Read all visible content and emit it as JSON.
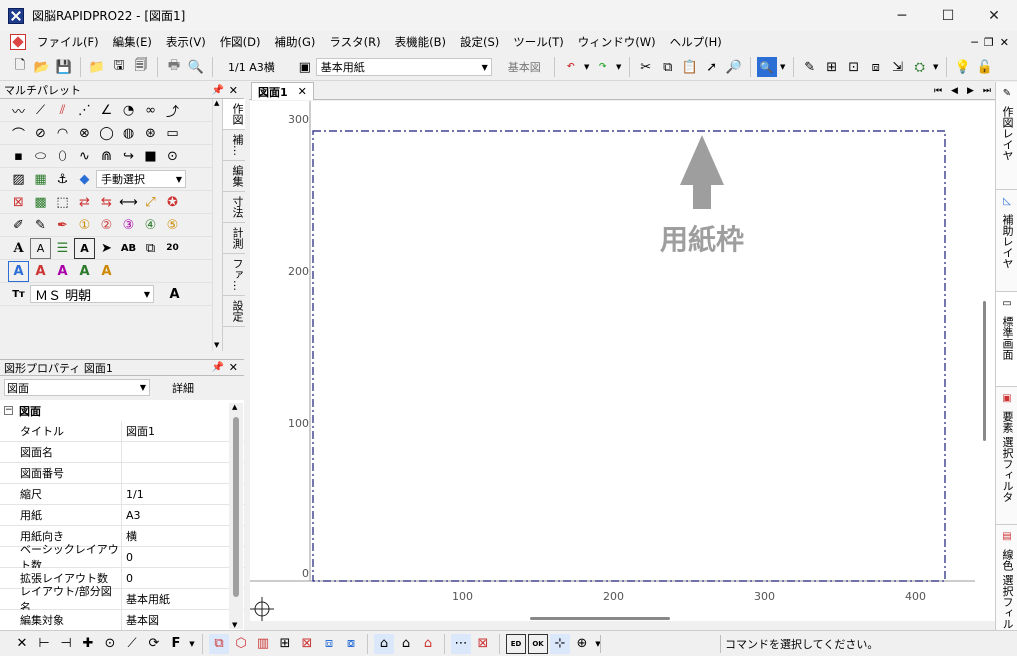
{
  "window": {
    "title": "図脳RAPIDPRO22 - [図面1]",
    "controls": [
      "─",
      "☐",
      "✕"
    ]
  },
  "menu": [
    "ファイル(F)",
    "編集(E)",
    "表示(V)",
    "作図(D)",
    "補助(G)",
    "ラスタ(R)",
    "表機能(B)",
    "設定(S)",
    "ツール(T)",
    "ウィンドウ(W)",
    "ヘルプ(H)"
  ],
  "toolbar": {
    "page_info": "1/1 A3横",
    "paper_combo": "基本用紙",
    "layout_label": "基本図"
  },
  "palette": {
    "title": "マルチパレット",
    "select_mode": "手動選択",
    "font_name": "ＭＳ 明朝",
    "tabs": [
      "作図",
      "補…",
      "編集",
      "寸法",
      "計測",
      "ファ…",
      "設定"
    ]
  },
  "properties": {
    "title": "図形プロパティ 図面1",
    "combo_value": "図面",
    "detail_label": "詳細",
    "group_label": "図面",
    "rows": [
      {
        "key": "タイトル",
        "value": "図面1"
      },
      {
        "key": "図面名",
        "value": ""
      },
      {
        "key": "図面番号",
        "value": ""
      },
      {
        "key": "縮尺",
        "value": "1/1"
      },
      {
        "key": "用紙",
        "value": "A3"
      },
      {
        "key": "用紙向き",
        "value": "横"
      },
      {
        "key": "ベーシックレイアウト数",
        "value": "0"
      },
      {
        "key": "拡張レイアウト数",
        "value": "0"
      },
      {
        "key": "レイアウト/部分図名",
        "value": "基本用紙"
      },
      {
        "key": "編集対象",
        "value": "基本図"
      }
    ]
  },
  "document": {
    "tab_label": "図面1",
    "annotation": "用紙枠",
    "y_ticks": [
      "300",
      "200",
      "100",
      "0"
    ],
    "x_ticks": [
      "100",
      "200",
      "300",
      "400"
    ]
  },
  "right_tabs": [
    "作図レイヤ",
    "補助レイヤ",
    "標準画面",
    "要素 選択フィルタ",
    "線色 選択フィル"
  ],
  "status": {
    "message": "コマンドを選択してください。"
  },
  "colors": {
    "paper_frame": "#1a1a7a",
    "annotation": "#9e9e9e",
    "ruler_text": "#555555"
  }
}
